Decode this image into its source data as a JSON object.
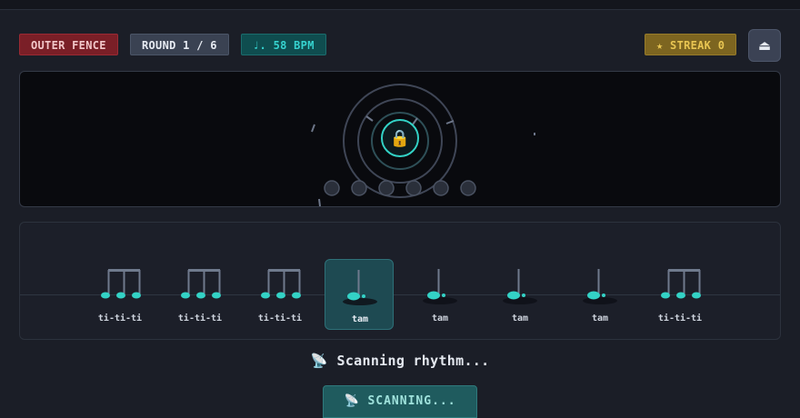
{
  "hud": {
    "zone": "OUTER FENCE",
    "round": "ROUND 1 / 6",
    "tempo": "♩. 58 BPM",
    "streak": "★ STREAK 0"
  },
  "exit_icon": "⏏",
  "lock_icon": "🔒",
  "lock_pins": {
    "total": 6,
    "set": 0
  },
  "rhythm": [
    {
      "label": "ti-ti-ti",
      "type": "triplet-eighths",
      "active": false
    },
    {
      "label": "ti-ti-ti",
      "type": "triplet-eighths",
      "active": false
    },
    {
      "label": "ti-ti-ti",
      "type": "triplet-eighths",
      "active": false
    },
    {
      "label": "tam",
      "type": "dotted-quarter",
      "active": true
    },
    {
      "label": "tam",
      "type": "dotted-quarter",
      "active": false
    },
    {
      "label": "tam",
      "type": "dotted-quarter",
      "active": false
    },
    {
      "label": "tam",
      "type": "dotted-quarter",
      "active": false
    },
    {
      "label": "ti-ti-ti",
      "type": "triplet-eighths",
      "active": false
    }
  ],
  "status": {
    "icon": "📡",
    "text": "Scanning rhythm..."
  },
  "scan_button": {
    "label": "📡 SCANNING..."
  },
  "colors": {
    "accent": "#33d2c6",
    "danger": "#7a1f27",
    "gold": "#e8c552"
  }
}
